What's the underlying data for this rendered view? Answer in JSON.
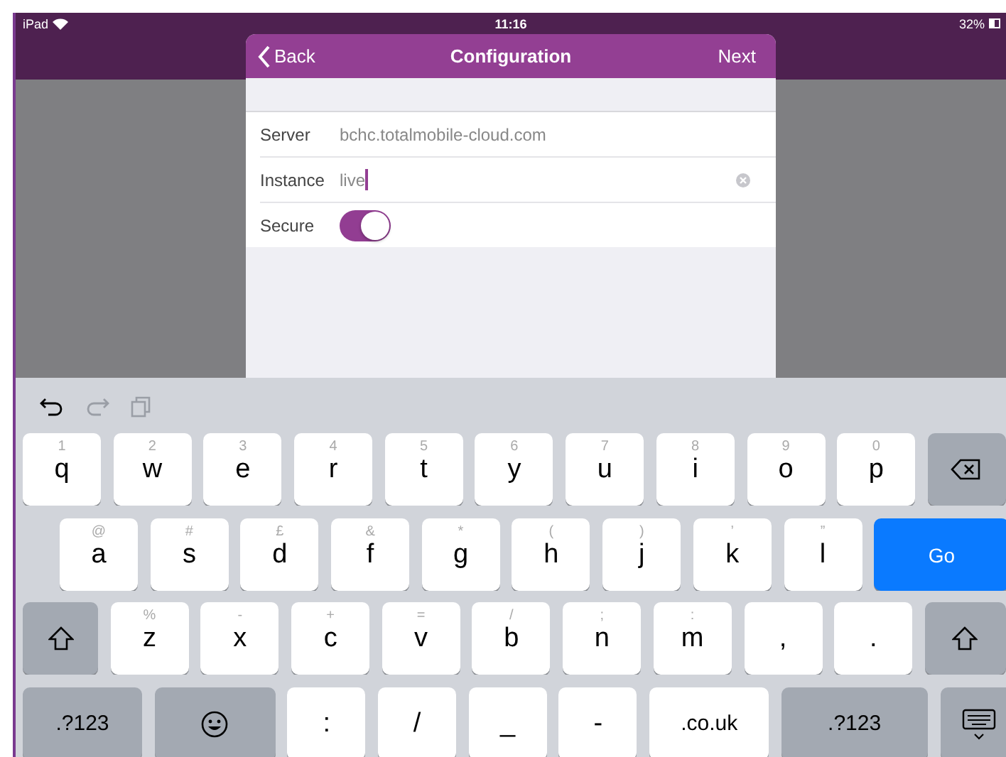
{
  "status_bar": {
    "device": "iPad",
    "time": "11:16",
    "battery": "32%"
  },
  "nav": {
    "back": "Back",
    "title": "Configuration",
    "next": "Next"
  },
  "fields": [
    {
      "kind": "text",
      "label": "Server",
      "value": "bchc.totalmobile-cloud.com"
    },
    {
      "kind": "input",
      "label": "Instance",
      "value": "live",
      "focused": true
    },
    {
      "kind": "toggle",
      "label": "Secure",
      "on": true
    }
  ],
  "keyboard": {
    "toolbar": [
      {
        "kind": "undo",
        "disabled": false
      },
      {
        "kind": "redo",
        "disabled": true
      },
      {
        "kind": "paste",
        "disabled": true
      }
    ],
    "rows": [
      {
        "keys": [
          {
            "kind": "letter",
            "label": "q",
            "hint": "1"
          },
          {
            "kind": "letter",
            "label": "w",
            "hint": "2"
          },
          {
            "kind": "letter",
            "label": "e",
            "hint": "3"
          },
          {
            "kind": "letter",
            "label": "r",
            "hint": "4"
          },
          {
            "kind": "letter",
            "label": "t",
            "hint": "5"
          },
          {
            "kind": "letter",
            "label": "y",
            "hint": "6"
          },
          {
            "kind": "letter",
            "label": "u",
            "hint": "7"
          },
          {
            "kind": "letter",
            "label": "i",
            "hint": "8"
          },
          {
            "kind": "letter",
            "label": "o",
            "hint": "9"
          },
          {
            "kind": "letter",
            "label": "p",
            "hint": "0"
          },
          {
            "kind": "backspace"
          }
        ]
      },
      {
        "keys": [
          {
            "kind": "letter",
            "label": "a",
            "hint": "@"
          },
          {
            "kind": "letter",
            "label": "s",
            "hint": "#"
          },
          {
            "kind": "letter",
            "label": "d",
            "hint": "£"
          },
          {
            "kind": "letter",
            "label": "f",
            "hint": "&"
          },
          {
            "kind": "letter",
            "label": "g",
            "hint": "*"
          },
          {
            "kind": "letter",
            "label": "h",
            "hint": "("
          },
          {
            "kind": "letter",
            "label": "j",
            "hint": ")"
          },
          {
            "kind": "letter",
            "label": "k",
            "hint": "’"
          },
          {
            "kind": "letter",
            "label": "l",
            "hint": "”"
          },
          {
            "kind": "go",
            "label": "Go"
          }
        ]
      },
      {
        "keys": [
          {
            "kind": "shift"
          },
          {
            "kind": "letter",
            "label": "z",
            "hint": "%"
          },
          {
            "kind": "letter",
            "label": "x",
            "hint": "-"
          },
          {
            "kind": "letter",
            "label": "c",
            "hint": "+"
          },
          {
            "kind": "letter",
            "label": "v",
            "hint": "="
          },
          {
            "kind": "letter",
            "label": "b",
            "hint": "/"
          },
          {
            "kind": "letter",
            "label": "n",
            "hint": ";"
          },
          {
            "kind": "letter",
            "label": "m",
            "hint": ":"
          },
          {
            "kind": "letter",
            "label": ","
          },
          {
            "kind": "letter",
            "label": "."
          },
          {
            "kind": "shift"
          }
        ]
      },
      {
        "keys": [
          {
            "kind": "mode",
            "label": ".?123"
          },
          {
            "kind": "emoji"
          },
          {
            "kind": "letter",
            "label": ":"
          },
          {
            "kind": "letter",
            "label": "/"
          },
          {
            "kind": "letter",
            "label": "_"
          },
          {
            "kind": "letter",
            "label": "-"
          },
          {
            "kind": "domain",
            "label": ".co.uk"
          },
          {
            "kind": "mode",
            "label": ".?123"
          },
          {
            "kind": "dismiss"
          }
        ]
      }
    ]
  }
}
